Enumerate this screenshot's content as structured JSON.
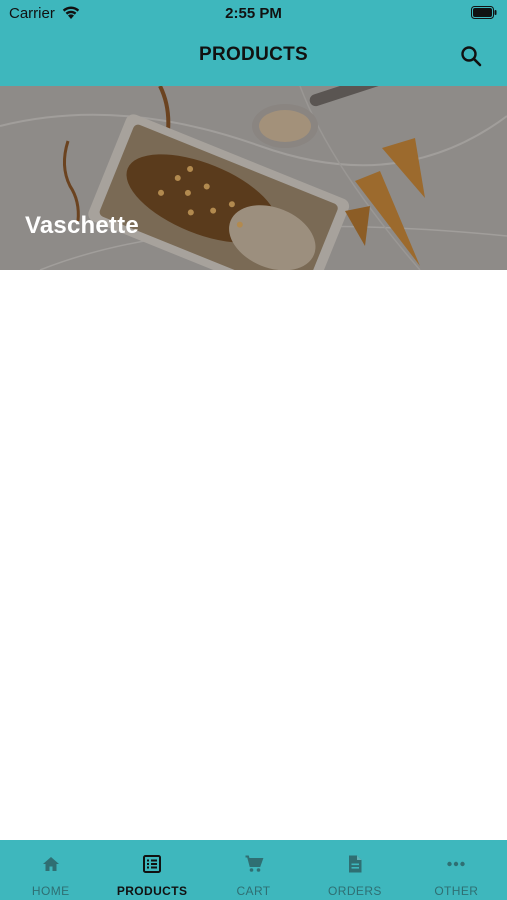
{
  "status_bar": {
    "carrier": "Carrier",
    "time": "2:55 PM"
  },
  "header": {
    "title": "PRODUCTS"
  },
  "banner": {
    "label": "Vaschette"
  },
  "tabs": [
    {
      "label": "HOME",
      "icon": "home-icon",
      "active": false
    },
    {
      "label": "PRODUCTS",
      "icon": "list-icon",
      "active": true
    },
    {
      "label": "CART",
      "icon": "cart-icon",
      "active": false
    },
    {
      "label": "ORDERS",
      "icon": "document-icon",
      "active": false
    },
    {
      "label": "OTHER",
      "icon": "more-icon",
      "active": false
    }
  ],
  "colors": {
    "accent": "#3eb7bd",
    "active_tab_text": "#111111",
    "inactive_tab_text": "#2f6f73"
  }
}
